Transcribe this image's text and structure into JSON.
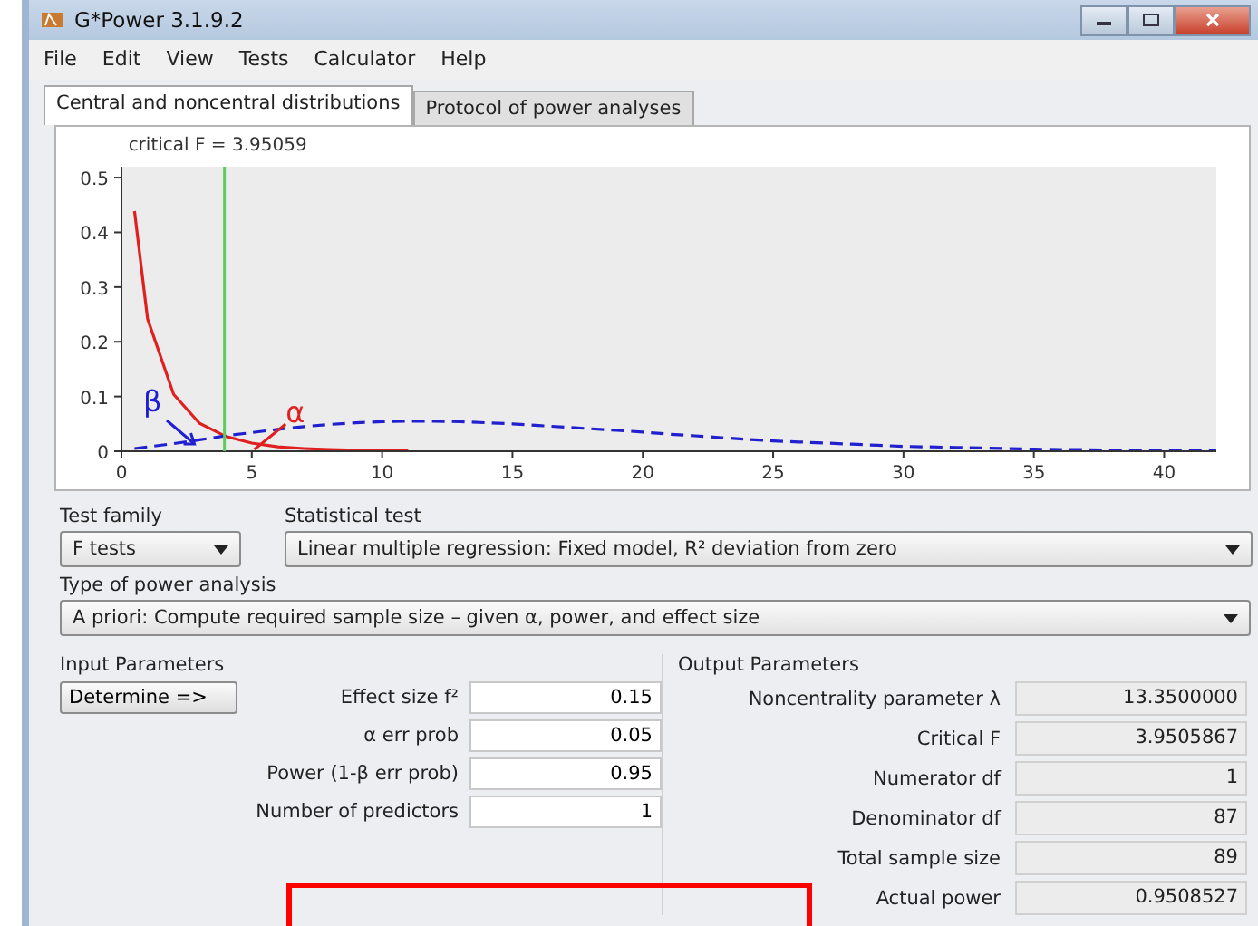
{
  "window": {
    "title": "G*Power 3.1.9.2"
  },
  "menu": [
    "File",
    "Edit",
    "View",
    "Tests",
    "Calculator",
    "Help"
  ],
  "tabs": [
    {
      "label": "Central and noncentral distributions",
      "selected": true
    },
    {
      "label": "Protocol of power analyses",
      "selected": false
    }
  ],
  "chart": {
    "chart_data": {
      "type": "line",
      "xlim": [
        0,
        42
      ],
      "ylim": [
        0,
        0.52
      ],
      "xticks": [
        0,
        5,
        10,
        15,
        20,
        25,
        30,
        35,
        40
      ],
      "yticks": [
        0,
        0.1,
        0.2,
        0.3,
        0.4,
        0.5
      ],
      "x": [
        0.5,
        1,
        2,
        3,
        4,
        5,
        6,
        7,
        8,
        9,
        10,
        11,
        12,
        13,
        14,
        15,
        16,
        17,
        18,
        19,
        20,
        21,
        22,
        23,
        24,
        25,
        26,
        27,
        28,
        29,
        30,
        31,
        32,
        33,
        34,
        35,
        36,
        37,
        38,
        39,
        40,
        41,
        42
      ],
      "series": [
        {
          "color": "#e02020",
          "line_style": "solid",
          "values": [
            0.439,
            0.242,
            0.104,
            0.051,
            0.027,
            0.015,
            0.008,
            0.005,
            0.003,
            0.002,
            0.001,
            0.001,
            null,
            null,
            null,
            null,
            null,
            null,
            null,
            null,
            null,
            null,
            null,
            null,
            null,
            null,
            null,
            null,
            null,
            null,
            null,
            null,
            null,
            null,
            null,
            null,
            null,
            null,
            null,
            null,
            null,
            null,
            null
          ]
        },
        {
          "color": "#2020d0",
          "line_style": "dashed",
          "values": [
            0.005,
            0.008,
            0.014,
            0.021,
            0.028,
            0.034,
            0.04,
            0.045,
            0.049,
            0.052,
            0.054,
            0.055,
            0.055,
            0.054,
            0.052,
            0.05,
            0.047,
            0.044,
            0.041,
            0.038,
            0.035,
            0.031,
            0.028,
            0.025,
            0.022,
            0.019,
            0.017,
            0.015,
            0.013,
            0.011,
            0.009,
            0.008,
            0.007,
            0.006,
            0.005,
            0.004,
            0.003,
            0.003,
            0.002,
            0.002,
            0.001,
            0.001,
            0.001
          ]
        }
      ],
      "ref_lines": [
        {
          "axis": "x",
          "value": 3.95059,
          "label": "critical F = 3.95059",
          "color": "#5ccc5c"
        }
      ],
      "annotations": [
        {
          "text": "β"
        },
        {
          "text": "α"
        }
      ]
    }
  },
  "test_family": {
    "label": "Test family",
    "value": "F tests"
  },
  "statistical_test": {
    "label": "Statistical test",
    "value": "Linear multiple regression: Fixed model, R² deviation from zero"
  },
  "power_analysis": {
    "label": "Type of power analysis",
    "value": "A priori: Compute required sample size – given α, power, and effect size"
  },
  "input_parameters": {
    "title": "Input Parameters",
    "button": "Determine =>",
    "fields": [
      {
        "label": "Effect size f²",
        "value": "0.15"
      },
      {
        "label": "α err prob",
        "value": "0.05"
      },
      {
        "label": "Power (1-β err prob)",
        "value": "0.95"
      },
      {
        "label": "Number of predictors",
        "value": "1"
      }
    ]
  },
  "output_parameters": {
    "title": "Output Parameters",
    "fields": [
      {
        "label": "Noncentrality parameter λ",
        "value": "13.3500000"
      },
      {
        "label": "Critical F",
        "value": "3.9505867"
      },
      {
        "label": "Numerator df",
        "value": "1"
      },
      {
        "label": "Denominator df",
        "value": "87"
      },
      {
        "label": "Total sample size",
        "value": "89"
      },
      {
        "label": "Actual power",
        "value": "0.9508527"
      }
    ]
  },
  "highlight": {
    "shown": true
  }
}
